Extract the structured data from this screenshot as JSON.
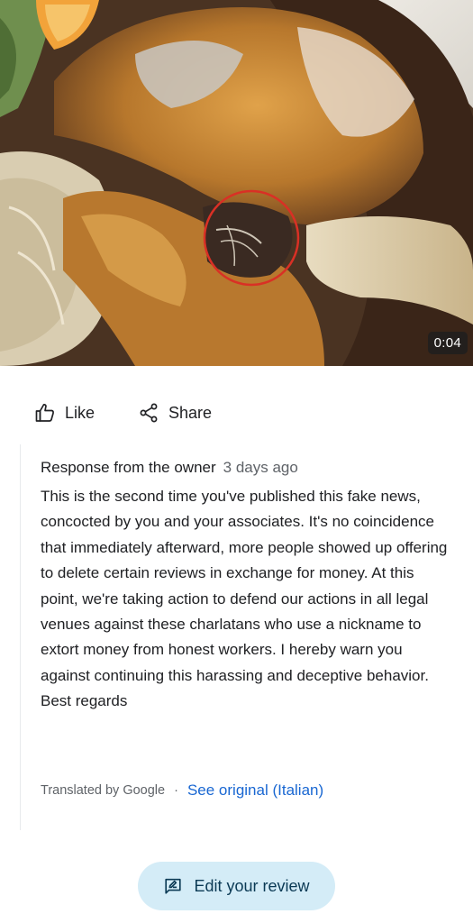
{
  "video": {
    "duration": "0:04",
    "highlight_color": "#d93025"
  },
  "actions": {
    "like_label": "Like",
    "share_label": "Share",
    "like_icon": "thumb-up-icon",
    "share_icon": "share-icon"
  },
  "owner_response": {
    "title": "Response from the owner",
    "date": "3 days ago",
    "text": "This is the second time you've published this fake news, concocted by you and your associates. It's no coincidence that immediately afterward, more people showed up offering to delete certain reviews in exchange for money. At this point, we're taking action to defend our actions in all legal venues against these charlatans who use a nickname to extort money from honest workers. I hereby warn you against continuing this harassing and deceptive behavior.",
    "closing": "Best regards",
    "translated_by": "Translated by Google",
    "separator": "·",
    "see_original": "See original (Italian)"
  },
  "edit_review": {
    "label": "Edit your review",
    "icon": "edit-review-icon",
    "bg_color": "#d4ecf7"
  }
}
